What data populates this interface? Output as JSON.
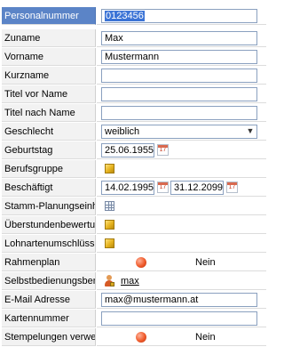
{
  "fields": {
    "personalnummer": {
      "label": "Personalnummer",
      "value": "0123456"
    },
    "zuname": {
      "label": "Zuname",
      "value": "Max"
    },
    "vorname": {
      "label": "Vorname",
      "value": "Mustermann"
    },
    "kurzname": {
      "label": "Kurzname",
      "value": ""
    },
    "titel_vor": {
      "label": "Titel vor Name",
      "value": ""
    },
    "titel_nach": {
      "label": "Titel nach Name",
      "value": ""
    },
    "geschlecht": {
      "label": "Geschlecht",
      "value": "weiblich"
    },
    "geburtstag": {
      "label": "Geburtstag",
      "value": "25.06.1955"
    },
    "berufsgruppe": {
      "label": "Berufsgruppe"
    },
    "beschaeftigt": {
      "label": "Beschäftigt",
      "from": "14.02.1995",
      "to": "31.12.2099"
    },
    "stamm_planung": {
      "label": "Stamm-Planungseinheit"
    },
    "ueberstunden": {
      "label": "Überstundenbewertung"
    },
    "lohnarten": {
      "label": "Lohnartenumschlüsselung"
    },
    "rahmenplan": {
      "label": "Rahmenplan",
      "value": "Nein"
    },
    "selbstbedienung": {
      "label": "Selbstbedienungsbenutzer",
      "value": "max"
    },
    "email": {
      "label": "E-Mail Adresse",
      "value": "max@mustermann.at"
    },
    "kartennummer": {
      "label": "Kartennummer",
      "value": ""
    },
    "stempelungen": {
      "label": "Stempelungen verwenden",
      "value": "Nein"
    }
  },
  "icons": {
    "calendar": "calendar-icon",
    "cube": "cube-icon",
    "grid": "table-grid-icon",
    "status": "red-status-dot-icon",
    "user": "user-lock-icon",
    "dropdown": "chevron-down-icon"
  },
  "colors": {
    "header_label_bg": "#5b84c7",
    "selection": "#3c74d6",
    "label_bg": "#f2f2f2",
    "status_dot": "#ef5a2a",
    "cube": "#e5b21e"
  }
}
